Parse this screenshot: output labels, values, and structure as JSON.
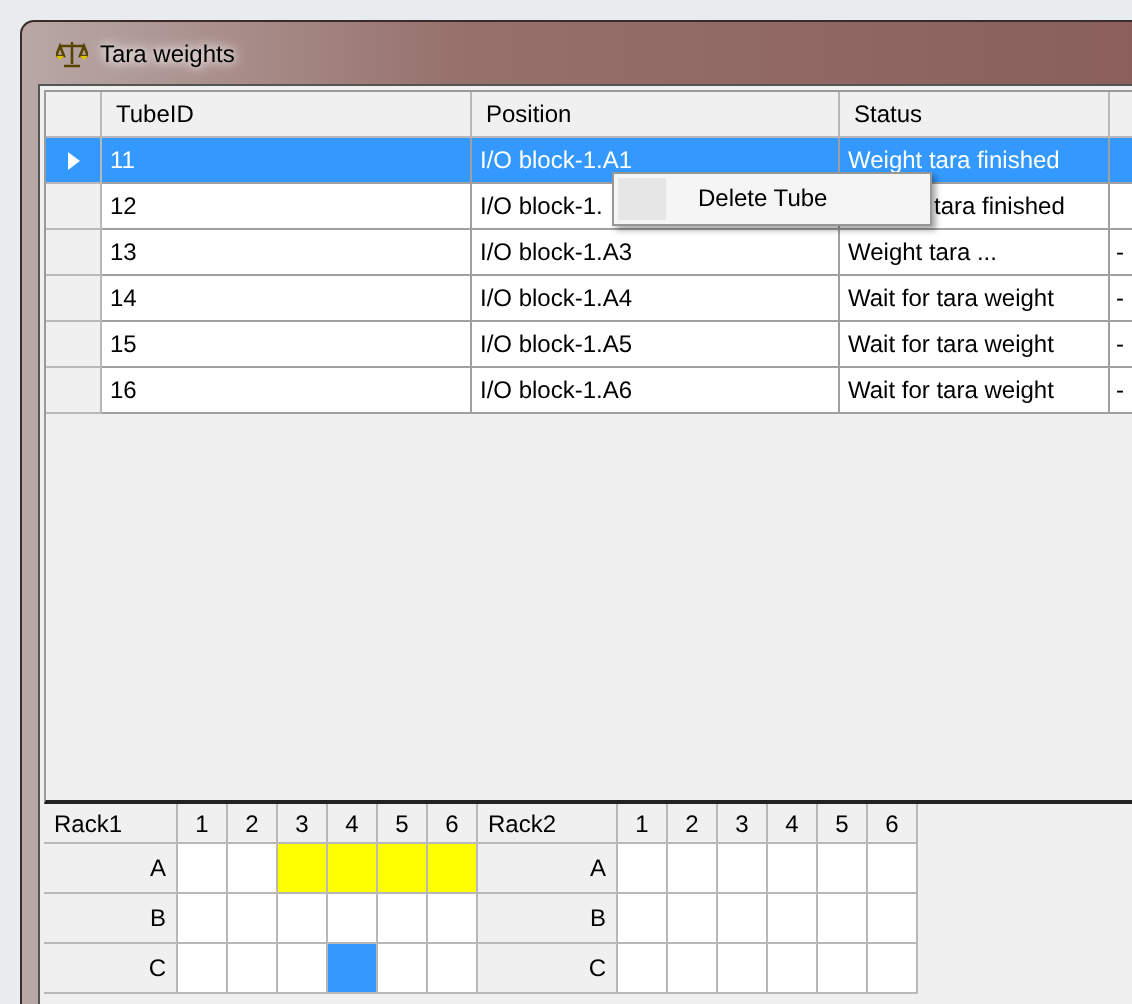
{
  "window": {
    "title": "Tara weights"
  },
  "table": {
    "columns": [
      "TubeID",
      "Position",
      "Status"
    ],
    "rows": [
      {
        "selected": true,
        "cells": [
          "11",
          "I/O block-1.A1",
          "Weight tara finished"
        ]
      },
      {
        "selected": false,
        "cells": [
          "12",
          "I/O block-1.",
          "tara finished"
        ]
      },
      {
        "selected": false,
        "cells": [
          "13",
          "I/O block-1.A3",
          "Weight tara ...",
          "-"
        ]
      },
      {
        "selected": false,
        "cells": [
          "14",
          "I/O block-1.A4",
          "Wait for tara weight",
          "-"
        ]
      },
      {
        "selected": false,
        "cells": [
          "15",
          "I/O block-1.A5",
          "Wait for tara weight",
          "-"
        ]
      },
      {
        "selected": false,
        "cells": [
          "16",
          "I/O block-1.A6",
          "Wait for tara weight",
          "-"
        ]
      }
    ]
  },
  "context_menu": {
    "items": [
      "Delete Tube"
    ]
  },
  "racks": [
    {
      "name": "Rack1",
      "columns": [
        "1",
        "2",
        "3",
        "4",
        "5",
        "6"
      ],
      "rows": [
        {
          "label": "A",
          "cells": [
            {
              "color": "#ffffff"
            },
            {
              "color": "#ffffff"
            },
            {
              "color": "#ffff00"
            },
            {
              "color": "#ffff00"
            },
            {
              "color": "#ffff00"
            },
            {
              "color": "#ffff00"
            }
          ]
        },
        {
          "label": "B",
          "cells": [
            {
              "color": "#ffffff"
            },
            {
              "color": "#ffffff"
            },
            {
              "color": "#ffffff"
            },
            {
              "color": "#ffffff"
            },
            {
              "color": "#ffffff"
            },
            {
              "color": "#ffffff"
            }
          ]
        },
        {
          "label": "C",
          "cells": [
            {
              "color": "#ffffff"
            },
            {
              "color": "#ffffff"
            },
            {
              "color": "#ffffff"
            },
            {
              "color": "#3399ff"
            },
            {
              "color": "#ffffff"
            },
            {
              "color": "#ffffff"
            }
          ]
        }
      ]
    },
    {
      "name": "Rack2",
      "columns": [
        "1",
        "2",
        "3",
        "4",
        "5",
        "6"
      ],
      "rows": [
        {
          "label": "A",
          "cells": [
            {
              "color": "#ffffff"
            },
            {
              "color": "#ffffff"
            },
            {
              "color": "#ffffff"
            },
            {
              "color": "#ffffff"
            },
            {
              "color": "#ffffff"
            },
            {
              "color": "#ffffff"
            }
          ]
        },
        {
          "label": "B",
          "cells": [
            {
              "color": "#ffffff"
            },
            {
              "color": "#ffffff"
            },
            {
              "color": "#ffffff"
            },
            {
              "color": "#ffffff"
            },
            {
              "color": "#ffffff"
            },
            {
              "color": "#ffffff"
            }
          ]
        },
        {
          "label": "C",
          "cells": [
            {
              "color": "#ffffff"
            },
            {
              "color": "#ffffff"
            },
            {
              "color": "#ffffff"
            },
            {
              "color": "#ffffff"
            },
            {
              "color": "#ffffff"
            },
            {
              "color": "#ffffff"
            }
          ]
        }
      ]
    }
  ]
}
